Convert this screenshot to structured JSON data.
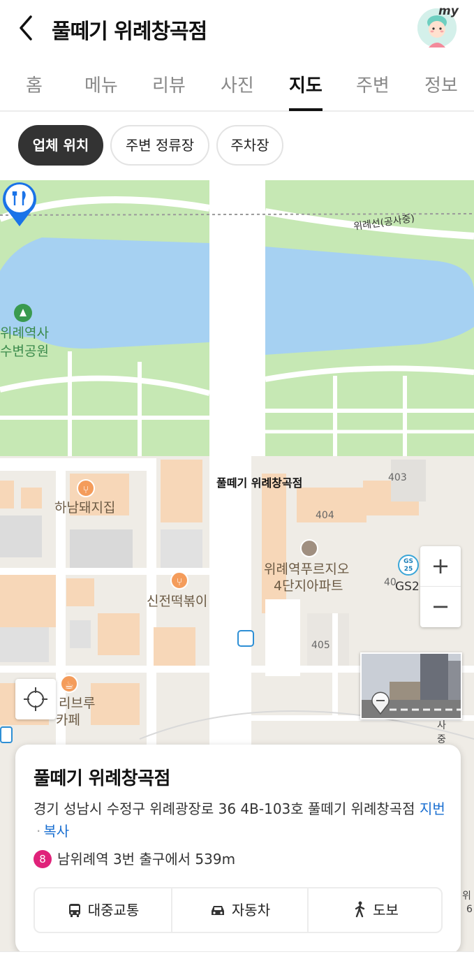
{
  "header": {
    "title": "풀떼기 위례창곡점",
    "avatar_badge": "my"
  },
  "tabs": [
    {
      "label": "홈"
    },
    {
      "label": "메뉴"
    },
    {
      "label": "리뷰"
    },
    {
      "label": "사진"
    },
    {
      "label": "지도",
      "active": true
    },
    {
      "label": "주변"
    },
    {
      "label": "정보"
    }
  ],
  "chips": [
    {
      "label": "업체 위치",
      "active": true
    },
    {
      "label": "주변 정류장"
    },
    {
      "label": "주차장"
    }
  ],
  "map": {
    "labels": {
      "park_line1": "위례역사",
      "park_line2": "수변공원",
      "railway": "위례선(공사중)",
      "place_name": "풀떼기 위례창곡점",
      "bldg_403": "403",
      "bldg_404": "404",
      "bldg_405": "405",
      "bldg_40x": "40",
      "restaurant1": "하남돼지집",
      "restaurant2": "신전떡볶이",
      "apartment_line1": "위례역푸르지오",
      "apartment_line2": "4단지아파트",
      "cafe_line1": "리브루",
      "cafe_line2": "카페",
      "gs_badge_line1": "GS",
      "gs_badge_line2": "25",
      "gs_label": "GS2",
      "edge_sa": "사",
      "edge_jung": "중",
      "edge_wi": "위",
      "edge_6": "6"
    },
    "zoom_in": "+",
    "zoom_out": "−"
  },
  "card": {
    "title": "풀떼기 위례창곡점",
    "address": "경기 성남시 수정구 위례광장로 36 4B-103호 풀떼기 위례창곡점",
    "jibun_link": "지번",
    "separator": "·",
    "copy_link": "복사",
    "subway_line": "8",
    "subway_text": "남위례역 3번 출구에서 539m",
    "routes": [
      {
        "label": "대중교통",
        "icon": "bus-icon"
      },
      {
        "label": "자동차",
        "icon": "car-icon"
      },
      {
        "label": "도보",
        "icon": "walk-icon"
      }
    ]
  },
  "colors": {
    "park": "#b9e4a6",
    "water": "#a6d1f2",
    "block": "#f7d7b8",
    "pin": "#1a73e8",
    "subway_line8": "#e0227a",
    "link": "#1a6fd1"
  }
}
